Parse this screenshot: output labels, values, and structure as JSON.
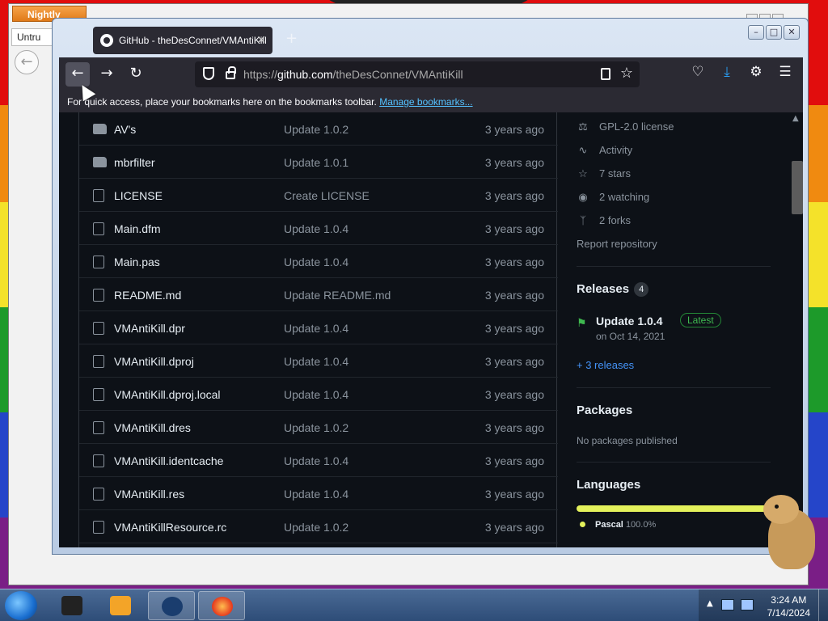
{
  "background_window": {
    "app_button": "Nightly",
    "tab_label": "Untru"
  },
  "window": {
    "tab_title": "GitHub - theDesConnet/VMAntiKill",
    "url_prefix": "https://",
    "url_host": "github.com",
    "url_path": "/theDesConnet/VMAntiKill",
    "bookmarks_prompt": "For quick access, place your bookmarks here on the bookmarks toolbar.",
    "manage_bookmarks": "Manage bookmarks..."
  },
  "files": [
    {
      "name": "AV's",
      "commit": "Update 1.0.2",
      "date": "3 years ago",
      "type": "folder"
    },
    {
      "name": "mbrfilter",
      "commit": "Update 1.0.1",
      "date": "3 years ago",
      "type": "folder"
    },
    {
      "name": "LICENSE",
      "commit": "Create LICENSE",
      "date": "3 years ago",
      "type": "file"
    },
    {
      "name": "Main.dfm",
      "commit": "Update 1.0.4",
      "date": "3 years ago",
      "type": "file"
    },
    {
      "name": "Main.pas",
      "commit": "Update 1.0.4",
      "date": "3 years ago",
      "type": "file"
    },
    {
      "name": "README.md",
      "commit": "Update README.md",
      "date": "3 years ago",
      "type": "file"
    },
    {
      "name": "VMAntiKill.dpr",
      "commit": "Update 1.0.4",
      "date": "3 years ago",
      "type": "file"
    },
    {
      "name": "VMAntiKill.dproj",
      "commit": "Update 1.0.4",
      "date": "3 years ago",
      "type": "file"
    },
    {
      "name": "VMAntiKill.dproj.local",
      "commit": "Update 1.0.4",
      "date": "3 years ago",
      "type": "file"
    },
    {
      "name": "VMAntiKill.dres",
      "commit": "Update 1.0.2",
      "date": "3 years ago",
      "type": "file"
    },
    {
      "name": "VMAntiKill.identcache",
      "commit": "Update 1.0.4",
      "date": "3 years ago",
      "type": "file"
    },
    {
      "name": "VMAntiKill.res",
      "commit": "Update 1.0.4",
      "date": "3 years ago",
      "type": "file"
    },
    {
      "name": "VMAntiKillResource.rc",
      "commit": "Update 1.0.2",
      "date": "3 years ago",
      "type": "file"
    }
  ],
  "sidebar": {
    "license": "GPL-2.0 license",
    "activity": "Activity",
    "stars": "7 stars",
    "watching": "2 watching",
    "forks": "2 forks",
    "report": "Report repository",
    "releases_heading": "Releases",
    "releases_count": "4",
    "latest_release_name": "Update 1.0.4",
    "latest_badge": "Latest",
    "latest_release_date": "on Oct 14, 2021",
    "more_releases": "+ 3 releases",
    "packages_heading": "Packages",
    "packages_text": "No packages published",
    "languages_heading": "Languages",
    "language_name": "Pascal",
    "language_percent": "100.0%",
    "language_color": "#e3f15b"
  },
  "taskbar": {
    "time": "3:24 AM",
    "date": "7/14/2024"
  }
}
